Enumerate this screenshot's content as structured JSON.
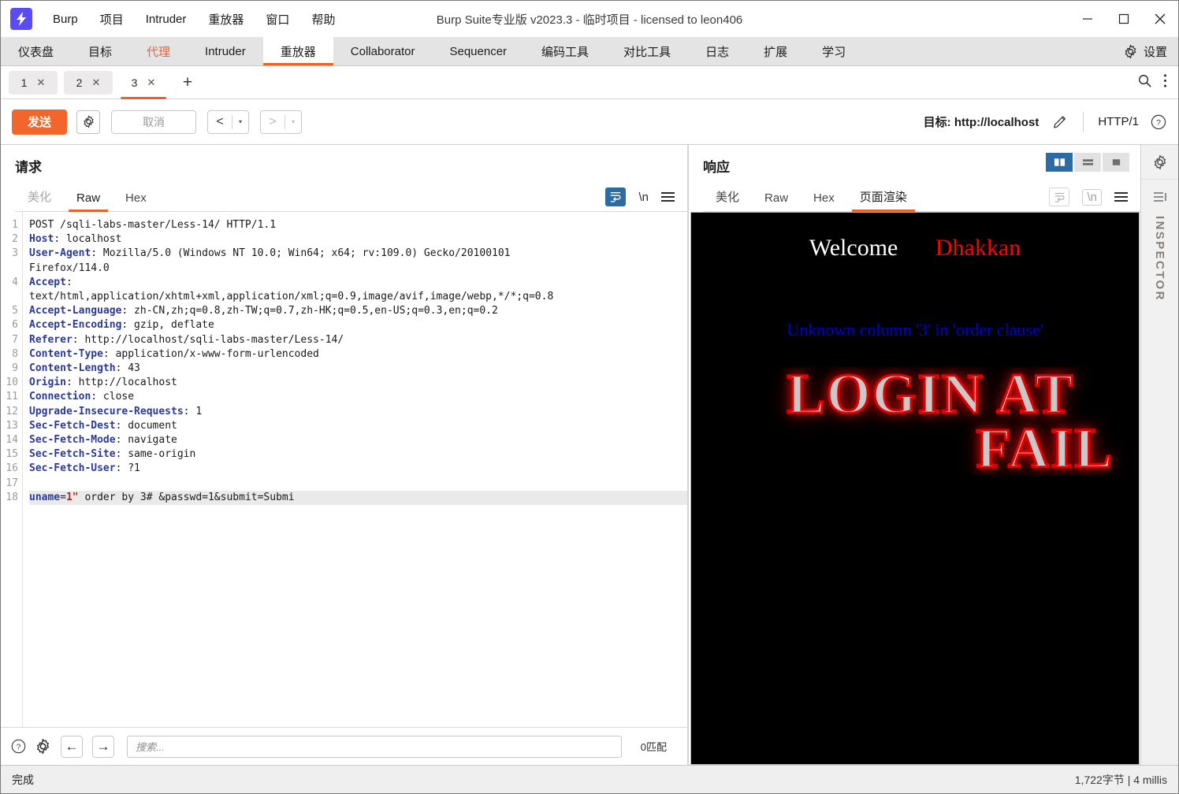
{
  "window": {
    "title": "Burp Suite专业版  v2023.3 - 临时项目 - licensed to leon406",
    "logo_glyph": "⚡",
    "minimize": "−",
    "maximize": "□",
    "close": "✕"
  },
  "menubar": {
    "items": [
      {
        "label": "Burp"
      },
      {
        "label": "项目"
      },
      {
        "label": "Intruder"
      },
      {
        "label": "重放器"
      },
      {
        "label": "窗口"
      },
      {
        "label": "帮助"
      }
    ]
  },
  "main_tabs": {
    "items": [
      {
        "label": "仪表盘",
        "state": "normal"
      },
      {
        "label": "目标",
        "state": "normal"
      },
      {
        "label": "代理",
        "state": "proxy"
      },
      {
        "label": "Intruder",
        "state": "normal"
      },
      {
        "label": "重放器",
        "state": "active"
      },
      {
        "label": "Collaborator",
        "state": "normal"
      },
      {
        "label": "Sequencer",
        "state": "normal"
      },
      {
        "label": "编码工具",
        "state": "normal"
      },
      {
        "label": "对比工具",
        "state": "normal"
      },
      {
        "label": "日志",
        "state": "normal"
      },
      {
        "label": "扩展",
        "state": "normal"
      },
      {
        "label": "学习",
        "state": "normal"
      }
    ],
    "settings_label": "设置"
  },
  "repeater_tabs": {
    "items": [
      {
        "label": "1",
        "close": "✕",
        "active": false
      },
      {
        "label": "2",
        "close": "✕",
        "active": false
      },
      {
        "label": "3",
        "close": "✕",
        "active": true
      }
    ],
    "add_label": "+"
  },
  "toolbar": {
    "send_label": "发送",
    "cancel_label": "取消",
    "back_glyph": "<",
    "forward_glyph": ">",
    "caret_glyph": "▾",
    "target_label": "目标: http://localhost",
    "http_version": "HTTP/1",
    "help_glyph": "?"
  },
  "request": {
    "title": "请求",
    "tabs": [
      {
        "label": "美化",
        "state": "dim"
      },
      {
        "label": "Raw",
        "state": "active"
      },
      {
        "label": "Hex",
        "state": "normal"
      }
    ],
    "newline_label": "\\n",
    "lines": [
      {
        "n": "1",
        "html": "POST /sqli-labs-master/Less-14/ HTTP/1.1"
      },
      {
        "n": "2",
        "html": "<b class='hdr'>Host</b>: localhost"
      },
      {
        "n": "3",
        "html": "<b class='hdr'>User-Agent</b>: Mozilla/5.0 (Windows NT 10.0; Win64; x64; rv:109.0) Gecko/20100101"
      },
      {
        "n": "",
        "html": "Firefox/114.0"
      },
      {
        "n": "4",
        "html": "<b class='hdr'>Accept</b>: "
      },
      {
        "n": "",
        "html": "text/html,application/xhtml+xml,application/xml;q=0.9,image/avif,image/webp,*/*;q=0.8"
      },
      {
        "n": "5",
        "html": "<b class='hdr'>Accept-Language</b>: zh-CN,zh;q=0.8,zh-TW;q=0.7,zh-HK;q=0.5,en-US;q=0.3,en;q=0.2"
      },
      {
        "n": "6",
        "html": "<b class='hdr'>Accept-Encoding</b>: gzip, deflate"
      },
      {
        "n": "7",
        "html": "<b class='hdr'>Referer</b>: http://localhost/sqli-labs-master/Less-14/"
      },
      {
        "n": "8",
        "html": "<b class='hdr'>Content-Type</b>: application/x-www-form-urlencoded"
      },
      {
        "n": "9",
        "html": "<b class='hdr'>Content-Length</b>: 43"
      },
      {
        "n": "10",
        "html": "<b class='hdr'>Origin</b>: http://localhost"
      },
      {
        "n": "11",
        "html": "<b class='hdr'>Connection</b>: close"
      },
      {
        "n": "12",
        "html": "<b class='hdr'>Upgrade-Insecure-Requests</b>: 1"
      },
      {
        "n": "13",
        "html": "<b class='hdr'>Sec-Fetch-Dest</b>: document"
      },
      {
        "n": "14",
        "html": "<b class='hdr'>Sec-Fetch-Mode</b>: navigate"
      },
      {
        "n": "15",
        "html": "<b class='hdr'>Sec-Fetch-Site</b>: same-origin"
      },
      {
        "n": "16",
        "html": "<b class='hdr'>Sec-Fetch-User</b>: ?1"
      },
      {
        "n": "17",
        "html": ""
      },
      {
        "n": "18",
        "html": "<span class='hl-row'><b class='param'>uname</b>=<b class='val'>1\"</b> order by 3# &amp;passwd=1&amp;submit=Submi</span>"
      }
    ],
    "footer": {
      "help_glyph": "?",
      "back_glyph": "←",
      "forward_glyph": "→",
      "search_placeholder": "搜索...",
      "match_count": "0匹配"
    }
  },
  "response": {
    "title": "响应",
    "tabs": [
      {
        "label": "美化",
        "state": "normal"
      },
      {
        "label": "Raw",
        "state": "normal"
      },
      {
        "label": "Hex",
        "state": "normal"
      },
      {
        "label": "页面渲染",
        "state": "active"
      }
    ],
    "newline_label": "\\n",
    "render": {
      "welcome_white": "Welcome",
      "welcome_red": "Dhakkan",
      "sql_error": "Unknown column '3' in 'order clause'",
      "fail_line1": "LOGIN AT",
      "fail_line2": "FAIL"
    }
  },
  "inspector": {
    "label": "INSPECTOR"
  },
  "statusbar": {
    "left": "完成",
    "right": "1,722字节 | 4 millis"
  },
  "colors": {
    "accent": "#ef6123",
    "send": "#f2662c",
    "blue_active": "#2b6ca3",
    "header_blue": "#2a3a96",
    "value_red": "#bb2222",
    "render_error_blue": "#0000d0"
  }
}
